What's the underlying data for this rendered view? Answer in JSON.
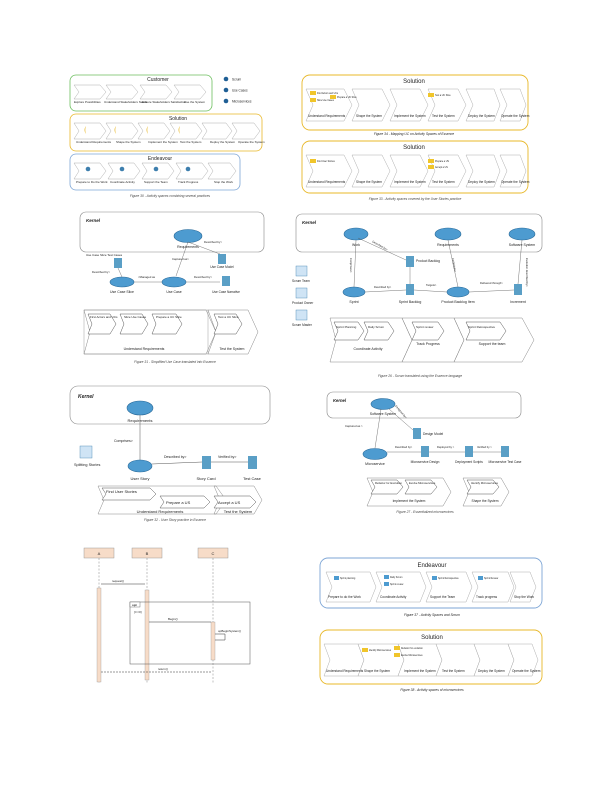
{
  "colors": {
    "customer": "#6dbf5f",
    "solution": "#e8b82a",
    "endeavour": "#7ea6d6",
    "alpha": "#3e7fae",
    "alpha_fill": "#4d9bd0",
    "workprod": "#5a9fc6",
    "legend_dot": "#1f5f95",
    "activity_icon": "#f0c52b"
  },
  "fig1": {
    "customer_title": "Customer",
    "solution_title": "Solution",
    "endeavour_title": "Endeavour",
    "customer_acts": [
      "Explore Possibilities",
      "Understand Stakeholders Needs",
      "Ensure Stakeholders Satisfaction",
      "Use the System"
    ],
    "solution_acts": [
      "Understand Requirements",
      "Shape the System",
      "Implement the System",
      "Test the System",
      "Deploy the System",
      "Operate the System"
    ],
    "endeavour_acts": [
      "Prepare to Do the Work",
      "Coordinate Activity",
      "Support the Team",
      "Track Progress",
      "Stop the Work"
    ],
    "legend": [
      "Scrum",
      "Use Cases",
      "Microservices"
    ],
    "caption": "Figure 30 - Activity spaces combining several practices"
  },
  "fig2": {
    "title_a": "Solution",
    "labels_a": [
      "Understand Requirements",
      "Shape the System",
      "Implement the System",
      "Test the System",
      "Deploy the System",
      "Operate the System"
    ],
    "mini_a": [
      "Find Actors and UCs",
      "Slice Use Cases",
      "Prepare a UC Slice",
      "Test a UC Slice"
    ],
    "caption_a": "Figure 34 - Mapping UC on Activity Spaces of Essence",
    "title_b": "Solution",
    "labels_b": [
      "Understand Requirements",
      "Shape the System",
      "Implement the System",
      "Test the System",
      "Deploy the System",
      "Operate the System"
    ],
    "mini_b": [
      "Find User Stories",
      "Prepare a US",
      "Accept a US"
    ],
    "caption_b": "Figure 33 - Activity spaces covered by the User Stories practice"
  },
  "fig3": {
    "kernel": "Kernel",
    "requirements": "Requirements",
    "use_case_slice": "Use Case Slice",
    "use_case": "Use Case",
    "use_case_model": "Use Case Model",
    "use_case_narrative": "Use Case Narrative",
    "slice_test_cases": "Use Case Slice Test Cases",
    "rel_described": "Described by>",
    "rel_captured": "Captured as>",
    "rel_managed": "<Managed as",
    "rel_described2": "Described by>",
    "rel_described3": "Described by>",
    "acts": [
      "First Actors and UCs",
      "Slice Use Cases",
      "Prepare a UC Slice",
      "Test a UC Slice"
    ],
    "space1": "Understand Requirements",
    "space2": "Test the System",
    "caption": "Figure 31 - Simplified Use Case translated into Essence"
  },
  "fig4": {
    "kernel": "Kernel",
    "work": "Work",
    "requirements": "Requirements",
    "software_system": "Software System",
    "product_backlog": "Product Backlog",
    "sprint": "Sprint",
    "sprint_backlog": "Sprint Backlog",
    "backlog_item": "Product Backlog Item",
    "increment": "Increment",
    "roles": [
      "Scrum Team",
      "Product Owner",
      "Scrum Master"
    ],
    "rel_described": "Described by>",
    "rel_comprises": "Comprises>",
    "rel_comprises2": "Comprises>",
    "rel_targets": "Targets>",
    "rel_delivered": "Delivered through>",
    "rel_evolution": "Evolution described by>",
    "rel_desc2": "Described by>",
    "acts": [
      "Sprint Planning",
      "Daily Scrum",
      "Sprint review",
      "Sprint Retrospective"
    ],
    "space1": "Coordinate Activity",
    "space2": "Track Progress",
    "space3": "Support the team",
    "caption": "Figure 26 - Scrum translated using the Essence language"
  },
  "fig5": {
    "kernel": "Kernel",
    "requirements": "Requirements",
    "splitting": "Splitting Stories",
    "rel_comprises": "Comprises>",
    "user_story": "User Story",
    "story_card": "Story Card",
    "test_case": "Test Case",
    "rel_described": "Described by>",
    "rel_verified": "Verified by>",
    "acts": [
      "Find User Stories",
      "Prepare a US",
      "Accept a US"
    ],
    "space1": "Understand Requirements",
    "space2": "Test the System",
    "caption": "Figure 32 - User Story practice in Essence"
  },
  "fig6": {
    "kernel": "Kernel",
    "software_system": "Software System",
    "design_model": "Design Model",
    "microservice": "Microservice",
    "ms_design": "Microservice Design",
    "deploy_scripts": "Deployment Scripts",
    "ms_test": "Microservice Test Case",
    "rel_captured": "Captured as >",
    "rel_described": "Described by>",
    "rel_deployed": "Deployed by >",
    "rel_verified": "Verified by >",
    "rel_designed": "Designed by>",
    "acts": [
      "Refactor for Evolution",
      "Evolve Microservices",
      "Identify Microservices"
    ],
    "space1": "Implement the System",
    "space2": "Shape the System",
    "caption": "Figure 27 - Essentialized microservices"
  },
  "fig7": {
    "lifelines": [
      "A",
      "B",
      "C"
    ],
    "msgs": [
      "request()",
      "Begin()",
      "opBeginSystem()",
      "return()"
    ],
    "frame": "opt",
    "guard": "[i>=0]"
  },
  "fig8": {
    "title": "Endeavour",
    "acts": [
      "Sprint planning",
      "Daily Scrum",
      "Sprint review",
      "Sprint Retrospective",
      "Sprint Review"
    ],
    "labels": [
      "Prepare to do the Work",
      "Coordinate Activity",
      "Support the Team",
      "Track progress",
      "Stop the Work"
    ],
    "caption": "Figure 37 - Activity Spaces and Scrum"
  },
  "fig9": {
    "title": "Solution",
    "acts": [
      "Identify Microservices",
      "Refactor for evolution",
      "Evolve Microservices"
    ],
    "labels": [
      "Understand Requirements",
      "Shape the System",
      "Implement the System",
      "Test the System",
      "Deploy the System",
      "Operate the System"
    ],
    "caption": "Figure 38 - Activity spaces of microservices"
  }
}
